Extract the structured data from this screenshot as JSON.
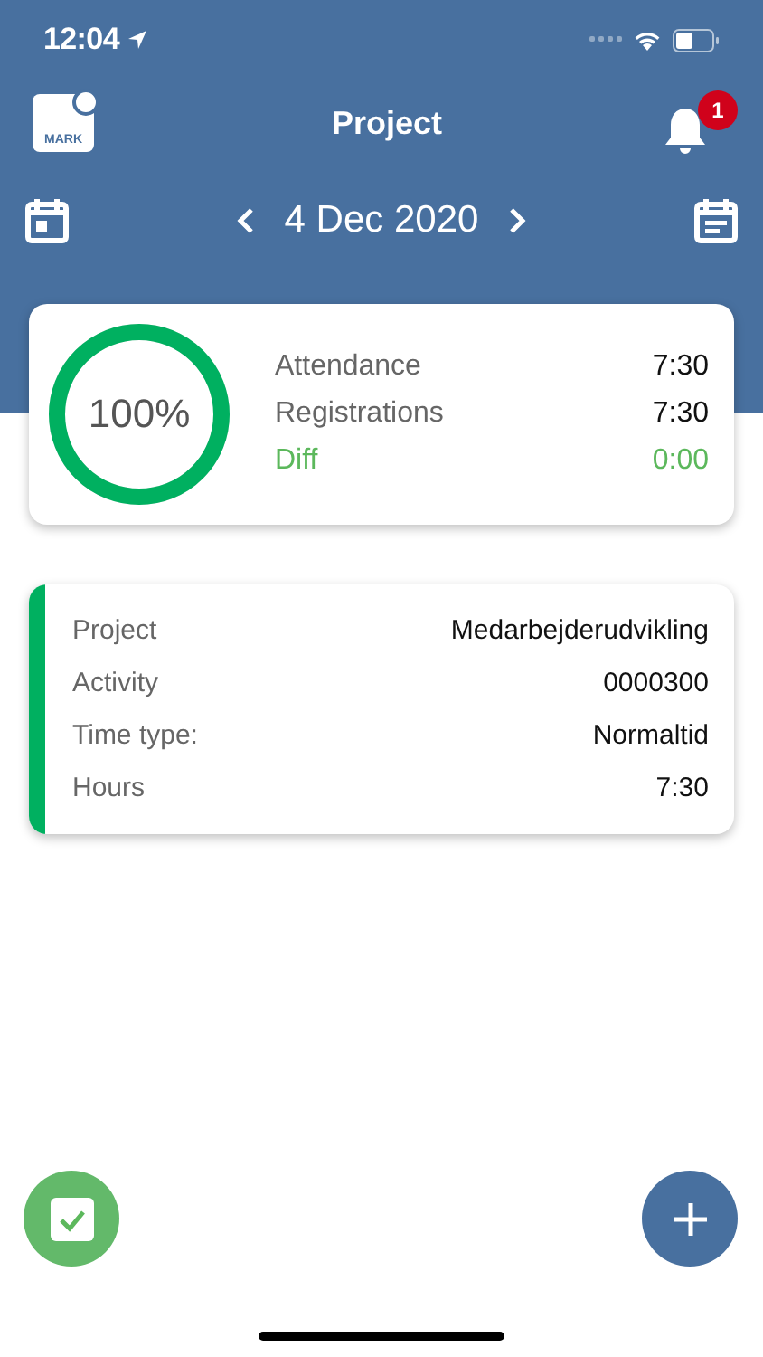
{
  "status_bar": {
    "time": "12:04"
  },
  "header": {
    "logo_text": "MARK",
    "title": "Project",
    "notifications": "1",
    "date": "4 Dec 2020"
  },
  "summary": {
    "level": 1,
    "percent": "100%",
    "rows": [
      {
        "kind": "total",
        "label": "Attendance",
        "value": "7:30"
      },
      {
        "kind": "total",
        "label": "Registrations",
        "value": "7:30"
      },
      {
        "kind": "diff",
        "label": "Diff",
        "value": "0:00"
      }
    ]
  },
  "entries": [
    {
      "color": "#00b060",
      "fields": [
        {
          "label": "Project",
          "value": "Medarbejderudvikling"
        },
        {
          "label": "Activity",
          "value": "0000300"
        },
        {
          "label": "Time type:",
          "value": "Normaltid"
        },
        {
          "label": "Hours",
          "value": "7:30"
        }
      ]
    }
  ]
}
